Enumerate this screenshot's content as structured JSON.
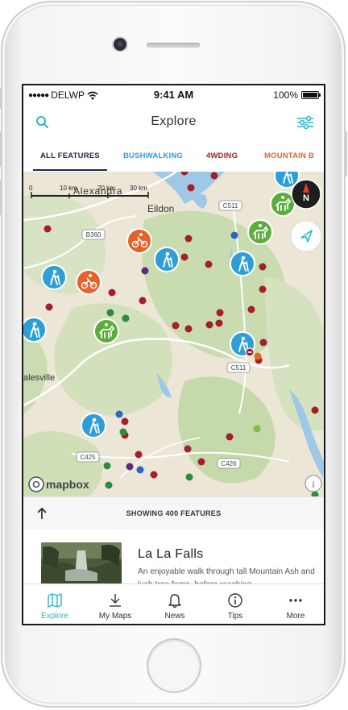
{
  "status": {
    "carrier": "DELWP",
    "time": "9:41 AM",
    "battery": "100%"
  },
  "header": {
    "title": "Explore",
    "search_icon": "search-icon",
    "filter_icon": "filter-sliders-icon"
  },
  "tabs": [
    {
      "label": "ALL FEATURES",
      "color": "#1c2b4b",
      "active": true
    },
    {
      "label": "BUSHWALKING",
      "color": "#2d9fd6",
      "active": false
    },
    {
      "label": "4WDING",
      "color": "#a3202a",
      "active": false
    },
    {
      "label": "MOUNTAIN B",
      "color": "#e6622a",
      "active": false
    }
  ],
  "map": {
    "scale_labels": [
      "0",
      "10 km",
      "20 km",
      "30 km"
    ],
    "place_labels": [
      "Alexandra",
      "Eildon",
      "alesville"
    ],
    "road_labels": [
      "C511",
      "B360",
      "C511",
      "C425",
      "C426"
    ],
    "attribution": "mapbox",
    "compass_label": "N",
    "info_label": "i",
    "marker_colors": {
      "bushwalking": "#2d9fd6",
      "cycling": "#e6622a",
      "horse_riding": "#5cae3c",
      "fourwd": "#a3202a",
      "camping": "#2a8c3d",
      "purple": "#5a2d82",
      "blue": "#2a66c8",
      "orange": "#e06a1a"
    }
  },
  "feature_bar": {
    "label": "SHOWING 400 FEATURES"
  },
  "card": {
    "title": "La La Falls",
    "description": "An enjoyable walk through tall Mountain Ash and lush tree ferns, before reaching"
  },
  "tabbar": [
    {
      "label": "Explore",
      "icon": "map-icon",
      "active": true
    },
    {
      "label": "My Maps",
      "icon": "download-icon",
      "active": false
    },
    {
      "label": "News",
      "icon": "bell-icon",
      "active": false
    },
    {
      "label": "Tips",
      "icon": "info-circle-icon",
      "active": false
    },
    {
      "label": "More",
      "icon": "more-dots-icon",
      "active": false
    }
  ],
  "colors": {
    "accent": "#2cb6c9",
    "text": "#333333"
  }
}
